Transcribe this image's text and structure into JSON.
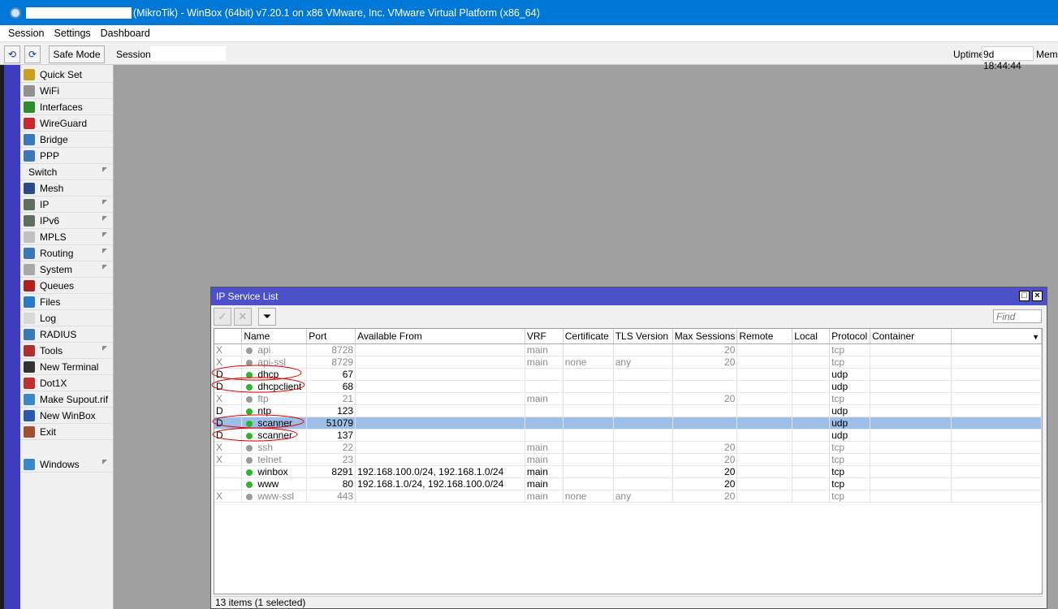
{
  "window_title": "(MikroTik) - WinBox (64bit) v7.20.1 on x86 VMware, Inc. VMware Virtual Platform (x86_64)",
  "menu": [
    "Session",
    "Settings",
    "Dashboard"
  ],
  "toolbar": {
    "safe_mode": "Safe Mode",
    "session_label": "Session:",
    "uptime_label": "Uptime:",
    "uptime_value": "9d 18:44:44",
    "memory_label": "Memo"
  },
  "sidebar": [
    {
      "label": "Quick Set",
      "icon": "wand-icon",
      "color": "#c8a020",
      "arrow": false
    },
    {
      "label": "WiFi",
      "icon": "wifi-icon",
      "color": "#909090",
      "arrow": false
    },
    {
      "label": "Interfaces",
      "icon": "interfaces-icon",
      "color": "#2e8b2e",
      "arrow": false
    },
    {
      "label": "WireGuard",
      "icon": "wireguard-icon",
      "color": "#c8282a",
      "arrow": false
    },
    {
      "label": "Bridge",
      "icon": "bridge-icon",
      "color": "#3a78b8",
      "arrow": false
    },
    {
      "label": "PPP",
      "icon": "ppp-icon",
      "color": "#3a78b8",
      "arrow": false
    },
    {
      "label": "Switch",
      "icon": "",
      "color": "",
      "arrow": true
    },
    {
      "label": "Mesh",
      "icon": "mesh-icon",
      "color": "#2a4a88",
      "arrow": false
    },
    {
      "label": "IP",
      "icon": "ip-icon",
      "color": "#607060",
      "arrow": true
    },
    {
      "label": "IPv6",
      "icon": "ipv6-icon",
      "color": "#607060",
      "arrow": true
    },
    {
      "label": "MPLS",
      "icon": "mpls-icon",
      "color": "#c0c0c0",
      "arrow": true
    },
    {
      "label": "Routing",
      "icon": "routing-icon",
      "color": "#3a78b8",
      "arrow": true
    },
    {
      "label": "System",
      "icon": "system-icon",
      "color": "#a8a8a8",
      "arrow": true
    },
    {
      "label": "Queues",
      "icon": "queues-icon",
      "color": "#b02020",
      "arrow": false
    },
    {
      "label": "Files",
      "icon": "files-icon",
      "color": "#2a7ac8",
      "arrow": false
    },
    {
      "label": "Log",
      "icon": "log-icon",
      "color": "#d8d8d8",
      "arrow": false
    },
    {
      "label": "RADIUS",
      "icon": "radius-icon",
      "color": "#3a78b8",
      "arrow": false
    },
    {
      "label": "Tools",
      "icon": "tools-icon",
      "color": "#b03030",
      "arrow": true
    },
    {
      "label": "New Terminal",
      "icon": "terminal-icon",
      "color": "#333333",
      "arrow": false
    },
    {
      "label": "Dot1X",
      "icon": "dot1x-icon",
      "color": "#c03030",
      "arrow": false
    },
    {
      "label": "Make Supout.rif",
      "icon": "supout-icon",
      "color": "#3a88c8",
      "arrow": false
    },
    {
      "label": "New WinBox",
      "icon": "winbox-icon",
      "color": "#2a5aa8",
      "arrow": false
    },
    {
      "label": "Exit",
      "icon": "exit-icon",
      "color": "#a05030",
      "arrow": false
    },
    {
      "label": "Windows",
      "icon": "windows-icon",
      "color": "#3a88c8",
      "arrow": true
    }
  ],
  "service_window": {
    "title": "IP Service List",
    "find_placeholder": "Find",
    "columns": [
      "",
      "Name",
      "Port",
      "Available From",
      "VRF",
      "Certificate",
      "TLS Version",
      "Max Sessions",
      "Remote",
      "Local",
      "Protocol",
      "Container",
      ""
    ],
    "rows": [
      {
        "flag": "X",
        "name": "api",
        "port": "8728",
        "from": "",
        "vrf": "main",
        "cert": "",
        "tls": "",
        "max": "20",
        "remote": "",
        "local": "",
        "proto": "tcp",
        "container": "",
        "state": "disabled"
      },
      {
        "flag": "X",
        "name": "api-ssl",
        "port": "8729",
        "from": "",
        "vrf": "main",
        "cert": "none",
        "tls": "any",
        "max": "20",
        "remote": "",
        "local": "",
        "proto": "tcp",
        "container": "",
        "state": "disabled"
      },
      {
        "flag": "D",
        "name": "dhcp",
        "port": "67",
        "from": "",
        "vrf": "",
        "cert": "",
        "tls": "",
        "max": "",
        "remote": "",
        "local": "",
        "proto": "udp",
        "container": "",
        "state": "enabled"
      },
      {
        "flag": "D",
        "name": "dhcpclient",
        "port": "68",
        "from": "",
        "vrf": "",
        "cert": "",
        "tls": "",
        "max": "",
        "remote": "",
        "local": "",
        "proto": "udp",
        "container": "",
        "state": "enabled"
      },
      {
        "flag": "X",
        "name": "ftp",
        "port": "21",
        "from": "",
        "vrf": "main",
        "cert": "",
        "tls": "",
        "max": "20",
        "remote": "",
        "local": "",
        "proto": "tcp",
        "container": "",
        "state": "disabled"
      },
      {
        "flag": "D",
        "name": "ntp",
        "port": "123",
        "from": "",
        "vrf": "",
        "cert": "",
        "tls": "",
        "max": "",
        "remote": "",
        "local": "",
        "proto": "udp",
        "container": "",
        "state": "enabled"
      },
      {
        "flag": "D",
        "name": "scanner",
        "port": "51079",
        "from": "",
        "vrf": "",
        "cert": "",
        "tls": "",
        "max": "",
        "remote": "",
        "local": "",
        "proto": "udp",
        "container": "",
        "state": "selected"
      },
      {
        "flag": "D",
        "name": "scanner",
        "port": "137",
        "from": "",
        "vrf": "",
        "cert": "",
        "tls": "",
        "max": "",
        "remote": "",
        "local": "",
        "proto": "udp",
        "container": "",
        "state": "enabled"
      },
      {
        "flag": "X",
        "name": "ssh",
        "port": "22",
        "from": "",
        "vrf": "main",
        "cert": "",
        "tls": "",
        "max": "20",
        "remote": "",
        "local": "",
        "proto": "tcp",
        "container": "",
        "state": "disabled"
      },
      {
        "flag": "X",
        "name": "telnet",
        "port": "23",
        "from": "",
        "vrf": "main",
        "cert": "",
        "tls": "",
        "max": "20",
        "remote": "",
        "local": "",
        "proto": "tcp",
        "container": "",
        "state": "disabled"
      },
      {
        "flag": "",
        "name": "winbox",
        "port": "8291",
        "from": "192.168.100.0/24, 192.168.1.0/24",
        "vrf": "main",
        "cert": "",
        "tls": "",
        "max": "20",
        "remote": "",
        "local": "",
        "proto": "tcp",
        "container": "",
        "state": "enabled"
      },
      {
        "flag": "",
        "name": "www",
        "port": "80",
        "from": "192.168.1.0/24, 192.168.100.0/24",
        "vrf": "main",
        "cert": "",
        "tls": "",
        "max": "20",
        "remote": "",
        "local": "",
        "proto": "tcp",
        "container": "",
        "state": "enabled"
      },
      {
        "flag": "X",
        "name": "www-ssl",
        "port": "443",
        "from": "",
        "vrf": "main",
        "cert": "none",
        "tls": "any",
        "max": "20",
        "remote": "",
        "local": "",
        "proto": "tcp",
        "container": "",
        "state": "disabled"
      }
    ],
    "status": "13 items (1 selected)"
  },
  "colors": {
    "title_bar": "#0078d7",
    "window_title": "#4c50c9",
    "selected_row": "#9dbfe7",
    "running_dot": "#2cb52c",
    "disabled_dot": "#9a9a9a",
    "annotation": "#e00000"
  }
}
